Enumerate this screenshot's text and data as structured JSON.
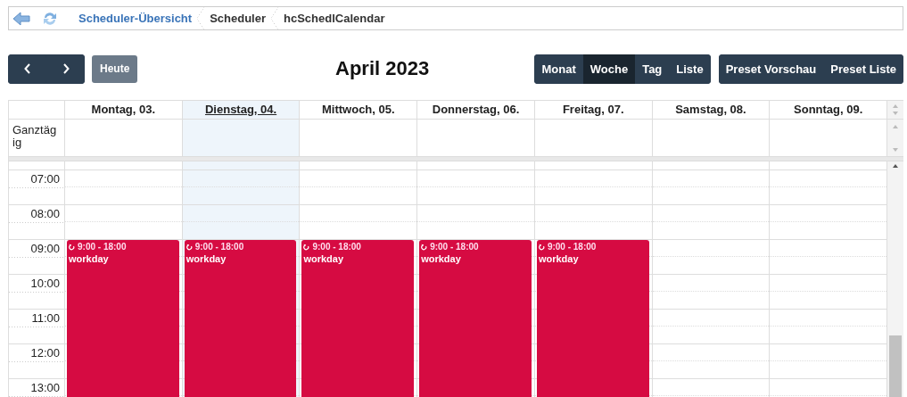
{
  "breadcrumbs": [
    {
      "label": "Scheduler-Übersicht",
      "link": true
    },
    {
      "label": "Scheduler",
      "link": false
    },
    {
      "label": "hcSchedlCalendar",
      "link": false
    }
  ],
  "toolbar": {
    "today_button": "Heute",
    "title": "April 2023",
    "views": [
      {
        "label": "Monat",
        "selected": false
      },
      {
        "label": "Woche",
        "selected": true
      },
      {
        "label": "Tag",
        "selected": false
      },
      {
        "label": "Liste",
        "selected": false
      }
    ],
    "presets": [
      "Preset Vorschau",
      "Preset Liste"
    ]
  },
  "calendar": {
    "all_day_label": "Ganztäg ig",
    "days": [
      {
        "label": "Montag, 03.",
        "today": false,
        "events": [
          {
            "time": "9:00 - 18:00",
            "title": "workday"
          }
        ]
      },
      {
        "label": "Dienstag, 04.",
        "today": true,
        "events": [
          {
            "time": "9:00 - 18:00",
            "title": "workday"
          }
        ]
      },
      {
        "label": "Mittwoch, 05.",
        "today": false,
        "events": [
          {
            "time": "9:00 - 18:00",
            "title": "workday"
          }
        ]
      },
      {
        "label": "Donnerstag, 06.",
        "today": false,
        "events": [
          {
            "time": "9:00 - 18:00",
            "title": "workday"
          }
        ]
      },
      {
        "label": "Freitag, 07.",
        "today": false,
        "events": [
          {
            "time": "9:00 - 18:00",
            "title": "workday"
          }
        ]
      },
      {
        "label": "Samstag, 08.",
        "today": false
      },
      {
        "label": "Sonntag, 09.",
        "today": false
      }
    ],
    "hours": [
      "07:00",
      "08:00",
      "09:00",
      "10:00",
      "11:00",
      "12:00",
      "13:00"
    ]
  }
}
